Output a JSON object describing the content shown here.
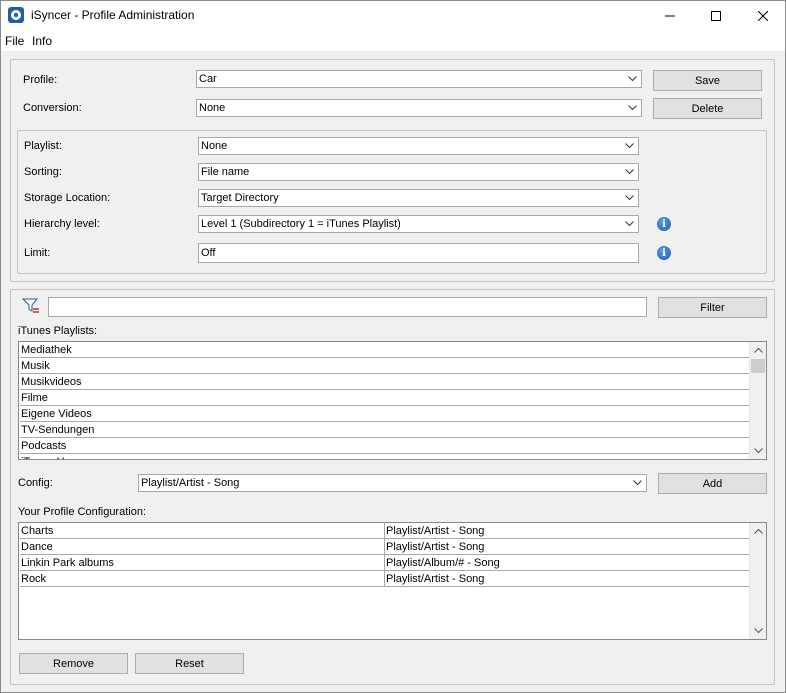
{
  "window": {
    "title": "iSyncer - Profile Administration"
  },
  "menu": {
    "file": "File",
    "info": "Info"
  },
  "profile": {
    "profile_label": "Profile:",
    "profile_value": "Car",
    "conversion_label": "Conversion:",
    "conversion_value": "None",
    "save_label": "Save",
    "delete_label": "Delete"
  },
  "settings": {
    "playlist_label": "Playlist:",
    "playlist_value": "None",
    "sorting_label": "Sorting:",
    "sorting_value": "File name",
    "storage_label": "Storage Location:",
    "storage_value": "Target Directory",
    "hierarchy_label": "Hierarchy level:",
    "hierarchy_value": "Level 1 (Subdirectory 1 = iTunes Playlist)",
    "limit_label": "Limit:",
    "limit_value": "Off"
  },
  "filter": {
    "value": "",
    "button_label": "Filter"
  },
  "playlists": {
    "label": "iTunes Playlists:",
    "items": [
      "Mediathek",
      "Musik",
      "Musikvideos",
      "Filme",
      "Eigene Videos",
      "TV-Sendungen",
      "Podcasts",
      "iTunes U"
    ]
  },
  "config": {
    "label": "Config:",
    "value": "Playlist/Artist - Song",
    "add_label": "Add"
  },
  "profile_config": {
    "label": "Your Profile Configuration:",
    "rows": [
      [
        "Charts",
        "Playlist/Artist - Song"
      ],
      [
        "Dance",
        "Playlist/Artist - Song"
      ],
      [
        "Linkin Park albums",
        "Playlist/Album/# - Song"
      ],
      [
        "Rock",
        "Playlist/Artist - Song"
      ]
    ],
    "remove_label": "Remove",
    "reset_label": "Reset"
  }
}
